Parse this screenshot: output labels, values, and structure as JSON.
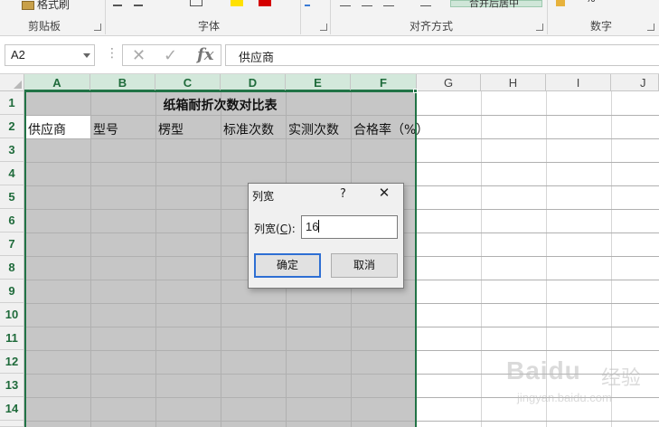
{
  "ribbon": {
    "format_painter": "格式刷",
    "groups": {
      "clipboard": "剪贴板",
      "font": "字体",
      "alignment": "对齐方式",
      "number": "数字"
    },
    "merge_center": "合并后居中",
    "percent": "%"
  },
  "formula_bar": {
    "name_box": "A2",
    "cancel_icon": "✕",
    "enter_icon": "✓",
    "fx": "fx",
    "content": "供应商"
  },
  "columns": [
    "A",
    "B",
    "C",
    "D",
    "E",
    "F",
    "G",
    "H",
    "I",
    "J"
  ],
  "rows": [
    "1",
    "2",
    "3",
    "4",
    "5",
    "6",
    "7",
    "8",
    "9",
    "10",
    "11",
    "12",
    "13",
    "14"
  ],
  "sheet": {
    "title": "纸箱耐折次数对比表",
    "headers": [
      "供应商",
      "型号",
      "楞型",
      "标准次数",
      "实测次数",
      "合格率（%）"
    ]
  },
  "dialog": {
    "title": "列宽",
    "help": "?",
    "close": "✕",
    "label_prefix": "列宽(",
    "label_key": "C",
    "label_suffix": "):",
    "value": "16",
    "ok": "确定",
    "cancel": "取消"
  },
  "watermark": {
    "brand": "Baidu",
    "cn": "经验",
    "url": "jingyan.baidu.com"
  },
  "colors": {
    "selection_green": "#217346",
    "header_selected": "#d3e8db",
    "selected_fill": "#c6c6c6"
  }
}
